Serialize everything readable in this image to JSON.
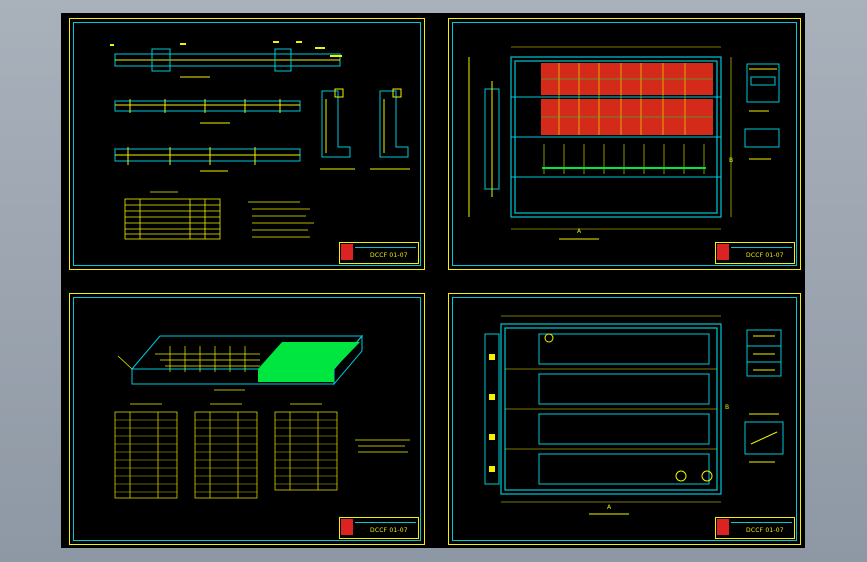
{
  "sheets": [
    {
      "id": "sheet-top-left",
      "drawing_no": "DCCF 01-07"
    },
    {
      "id": "sheet-top-right",
      "drawing_no": "DCCF 01-07"
    },
    {
      "id": "sheet-bottom-left",
      "drawing_no": "DCCF 01-07"
    },
    {
      "id": "sheet-bottom-right",
      "drawing_no": "DCCF 01-07"
    }
  ],
  "section_labels": {
    "tr_a": "A",
    "tr_b": "B",
    "br_a": "A",
    "br_b": "B"
  },
  "colors": {
    "sheet_border": "#f2f200",
    "inner_frame": "#00c8d8",
    "rebar_fill": "#d42a1a",
    "accent_green": "#00e640",
    "background": "#000000"
  }
}
